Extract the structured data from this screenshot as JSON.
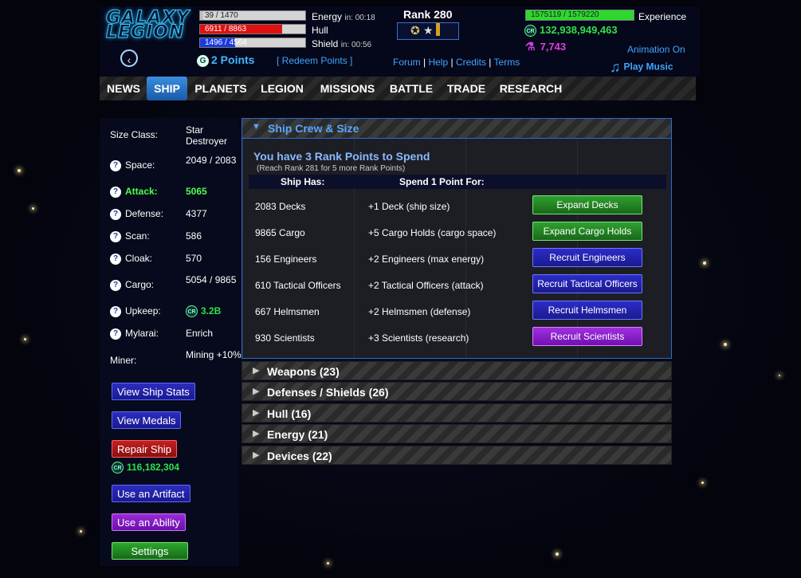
{
  "header": {
    "logo_text": "GALAXY LEGION",
    "energy": {
      "bar_text": "39 / 1470",
      "label": "Energy",
      "timer": "in: 00:18",
      "fill": 0.03
    },
    "hull": {
      "bar_text": "6911 / 8863",
      "label": "Hull",
      "fill": 0.78
    },
    "shield": {
      "bar_text": "1496 / 4564",
      "label": "Shield",
      "timer": "in: 00:56",
      "fill": 0.33
    },
    "points": "2 Points",
    "redeem": "[ Redeem Points ]",
    "rank": "Rank 280",
    "links": [
      "Forum",
      "Help",
      "Credits",
      "Terms"
    ],
    "experience": {
      "bar_text": "1575119 / 1579220",
      "label": "Experience",
      "fill": 0.997
    },
    "credits": "132,938,949,463",
    "research_points": "7,743",
    "animation": "Animation On",
    "music": "Play Music"
  },
  "nav": [
    "NEWS",
    "SHIP",
    "PLANETS",
    "LEGION",
    "MISSIONS",
    "BATTLE",
    "TRADE",
    "RESEARCH"
  ],
  "nav_active": "SHIP",
  "sidebar": {
    "size_class_label": "Size Class:",
    "size_class_value": "Star Destroyer",
    "stats": [
      {
        "label": "Space:",
        "value": "2049 / 2083"
      },
      {
        "label": "Attack:",
        "value": "5065"
      },
      {
        "label": "Defense:",
        "value": "4377"
      },
      {
        "label": "Scan:",
        "value": "586"
      },
      {
        "label": "Cloak:",
        "value": "570"
      },
      {
        "label": "Cargo:",
        "value": "5054 / 9865"
      },
      {
        "label": "Upkeep:",
        "value": "3.2B"
      },
      {
        "label": "Mylarai:",
        "value": "Enrich"
      }
    ],
    "miner_label": "Miner:",
    "miner_value": "Mining +10%",
    "buttons": {
      "view_stats": "View Ship Stats",
      "view_medals": "View Medals",
      "repair": "Repair Ship",
      "repair_cost": "116,182,304",
      "artifact": "Use an Artifact",
      "ability": "Use an Ability",
      "settings": "Settings"
    }
  },
  "panel": {
    "title": "Ship Crew & Size",
    "rank_points_title": "You have 3 Rank Points to Spend",
    "rank_points_sub": "(Reach Rank 281 for 5 more Rank Points)",
    "col_has": "Ship Has:",
    "col_spend": "Spend 1 Point For:",
    "rows": [
      {
        "has": "2083 Decks",
        "gain": "+1 Deck (ship size)",
        "button": "Expand Decks",
        "color": "green"
      },
      {
        "has": "9865 Cargo",
        "gain": "+5 Cargo Holds (cargo space)",
        "button": "Expand Cargo Holds",
        "color": "green"
      },
      {
        "has": "156 Engineers",
        "gain": "+2 Engineers (max energy)",
        "button": "Recruit Engineers",
        "color": "blue"
      },
      {
        "has": "610 Tactical Officers",
        "gain": "+2 Tactical Officers (attack)",
        "button": "Recruit Tactical Officers",
        "color": "blue"
      },
      {
        "has": "667 Helmsmen",
        "gain": "+2 Helmsmen (defense)",
        "button": "Recruit Helmsmen",
        "color": "blue"
      },
      {
        "has": "930 Scientists",
        "gain": "+3 Scientists (research)",
        "button": "Recruit Scientists",
        "color": "purple"
      }
    ]
  },
  "sections": [
    "Weapons (23)",
    "Defenses / Shields (26)",
    "Hull (16)",
    "Energy (21)",
    "Devices (22)"
  ],
  "colors": {
    "accent": "#3fa6ff",
    "credits": "#2fe04a",
    "research": "#e040e0",
    "attack": "#4cff4c"
  }
}
